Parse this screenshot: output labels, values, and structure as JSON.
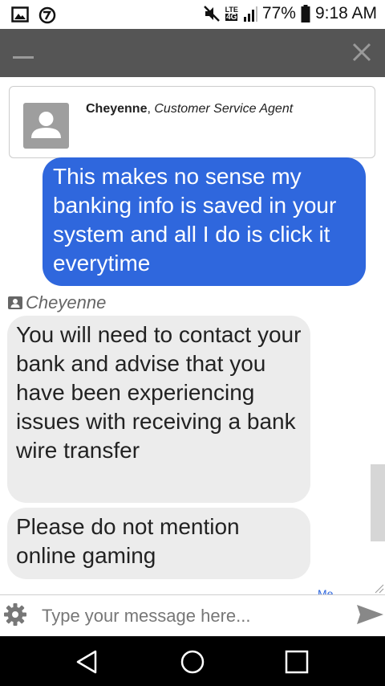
{
  "status_bar": {
    "network_badge": "4G",
    "lte_label": "LTE",
    "battery": "77%",
    "time": "9:18 AM",
    "icons": [
      "gallery-icon",
      "browser-icon",
      "mute-icon",
      "signal-icon",
      "battery-icon"
    ]
  },
  "agent": {
    "name": "Cheyenne",
    "role": "Customer Service Agent"
  },
  "messages": {
    "outgoing_1": "This makes no sense my banking info is saved in your system and all I do is click it everytime",
    "sender": "Cheyenne",
    "incoming_1": "You will need to contact your bank and advise that you have been experiencing issues with receiving a bank wire transfer",
    "incoming_2": "Please do not mention online gaming",
    "partial": "Me"
  },
  "composer": {
    "placeholder": "Type your message here..."
  },
  "colors": {
    "header": "#555555",
    "outgoing_bubble": "#2f67dd",
    "incoming_bubble": "#ececec",
    "avatar": "#9e9e9e",
    "navbar": "#000000"
  }
}
